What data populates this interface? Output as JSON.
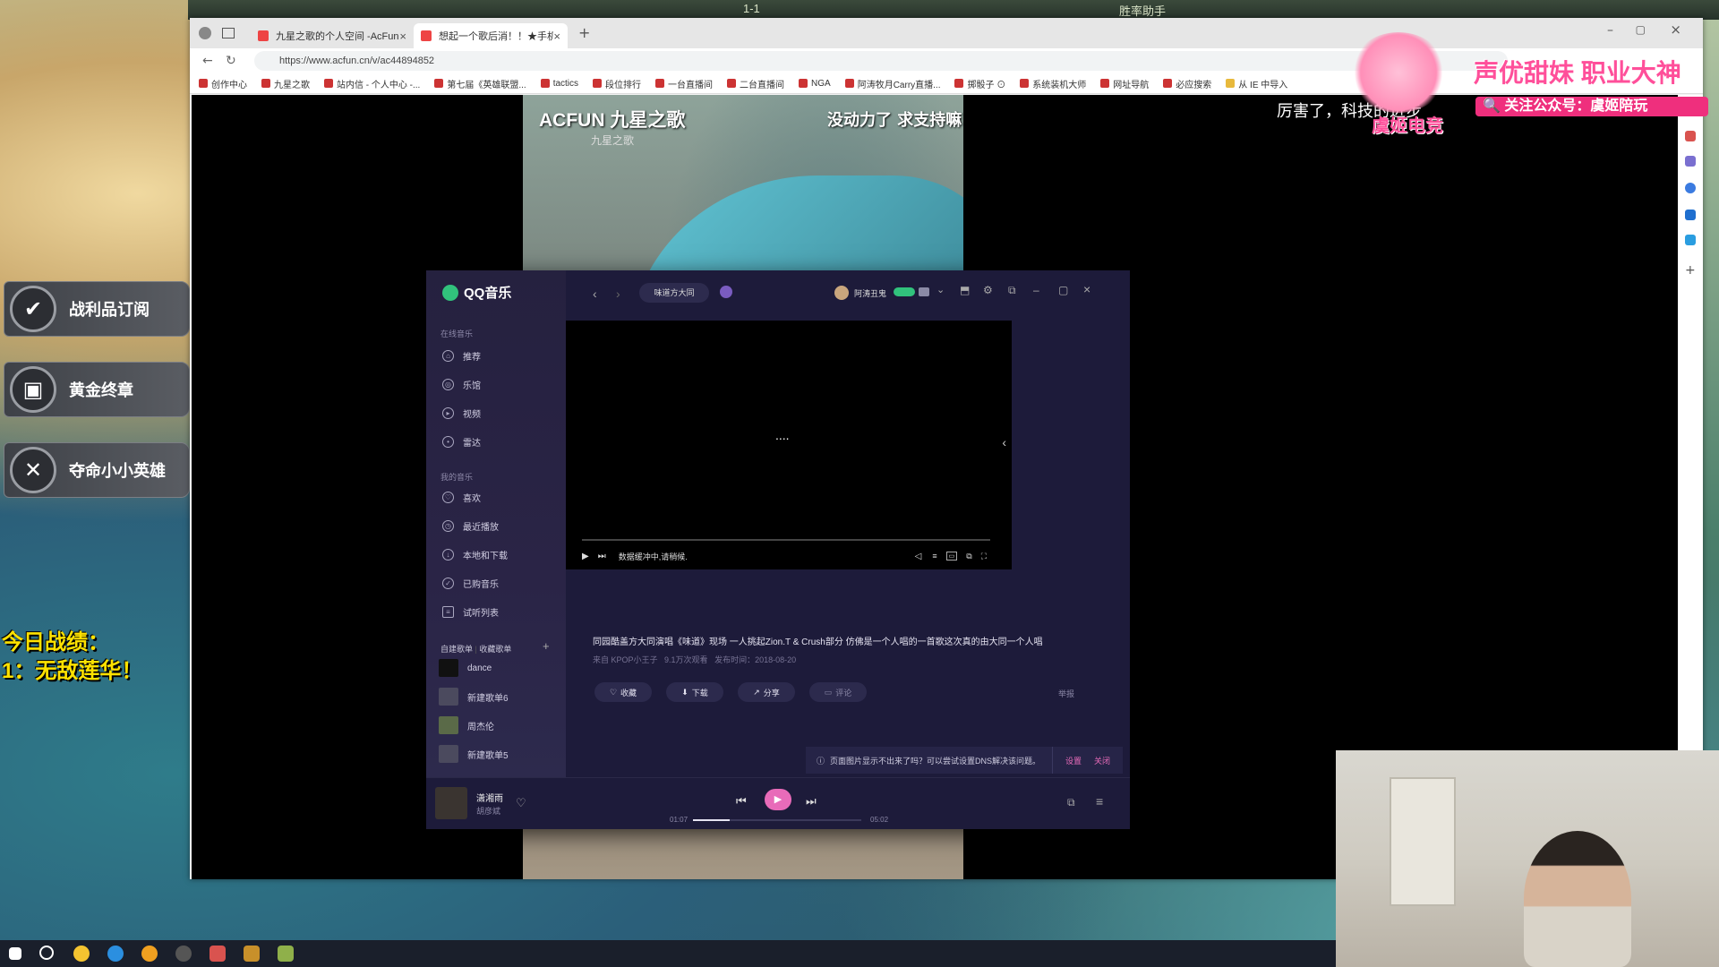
{
  "game": {
    "top_hud": [
      "1-1",
      "胜率助手"
    ],
    "side_buttons": [
      {
        "label": "战利品订阅",
        "icon": "checkmark-icon"
      },
      {
        "label": "黄金终章",
        "icon": "lock-icon"
      },
      {
        "label": "夺命小小英雄",
        "icon": "crossed-swords-icon"
      }
    ],
    "record_title": "今日战绩：",
    "record_line": "1：无敌莲华！"
  },
  "browser": {
    "tabs": [
      {
        "label": "九星之歌的个人空间 -AcFun弹幕...",
        "active": false
      },
      {
        "label": "想起一个歌后消！！★手机室...",
        "active": true
      }
    ],
    "url": "https://www.acfun.cn/v/ac44894852",
    "bookmarks": [
      "创作中心",
      "九星之歌",
      "站内信 - 个人中心 -...",
      "第七届《英雄联盟...",
      "tactics",
      "段位排行",
      "一台直播间",
      "二台直播间",
      "NGA",
      "阿涛牧月Carry直播...",
      "掷骰子 ⊙",
      "系统装机大师",
      "网址导航",
      "必应搜索",
      "从 IE 中导入"
    ]
  },
  "video": {
    "logo": "ACFUN 九星之歌",
    "watermark": "九星之歌",
    "caption": "没动力了 求支持嘛",
    "danmu": "厉害了，科技的进步"
  },
  "overlay": {
    "title": "声优甜妹 职业大神",
    "follow": "关注公众号：虞姬陪玩",
    "sub": "虞姬电竞"
  },
  "qq": {
    "app_name": "QQ音乐",
    "search_tag": "味道方大同",
    "username": "阿涛丑鬼",
    "online_music_header": "在线音乐",
    "online_music": [
      {
        "label": "推荐",
        "icon": "home-icon"
      },
      {
        "label": "乐馆",
        "icon": "compass-icon"
      },
      {
        "label": "视频",
        "icon": "play-circle-icon"
      },
      {
        "label": "雷达",
        "icon": "radar-icon"
      }
    ],
    "my_music_header": "我的音乐",
    "my_music": [
      {
        "label": "喜欢",
        "icon": "heart-icon"
      },
      {
        "label": "最近播放",
        "icon": "clock-icon"
      },
      {
        "label": "本地和下载",
        "icon": "download-icon"
      },
      {
        "label": "已购音乐",
        "icon": "bag-icon"
      },
      {
        "label": "试听列表",
        "icon": "list-icon"
      }
    ],
    "playlist_tabs": [
      "自建歌单",
      "收藏歌单"
    ],
    "playlists": [
      "dance",
      "新建歌单6",
      "周杰伦",
      "新建歌单5"
    ],
    "video_status": "数据缓冲中,请稍候.",
    "video_loading": "....",
    "video_title": "同园酷盖方大同演唱《味道》现场 一人挑起Zion.T & Crush部分 仿佛是一个人唱的一首歌这次真的由大同一个人唱",
    "video_meta": {
      "source": "来自 KPOP小王子",
      "views": "9.1万次观看",
      "date": "发布时间：2018-08-20"
    },
    "actions": {
      "favorite": "收藏",
      "download": "下载",
      "share": "分享",
      "comment": "评论",
      "report": "举报"
    },
    "notice": {
      "text": "页面图片显示不出来了吗？可以尝试设置DNS解决该问题。",
      "settings": "设置",
      "close": "关闭"
    },
    "now_playing": {
      "title": "潇湘雨",
      "artist": "胡彦斌",
      "current": "01:07",
      "total": "05:02",
      "progress": 0.22
    },
    "video_progress": 0.0
  },
  "colors": {
    "qq_green": "#31c27c",
    "qq_play": "#e86bb9",
    "overlay_pink": "#ef2f7d",
    "record_yellow": "#ffe200"
  }
}
